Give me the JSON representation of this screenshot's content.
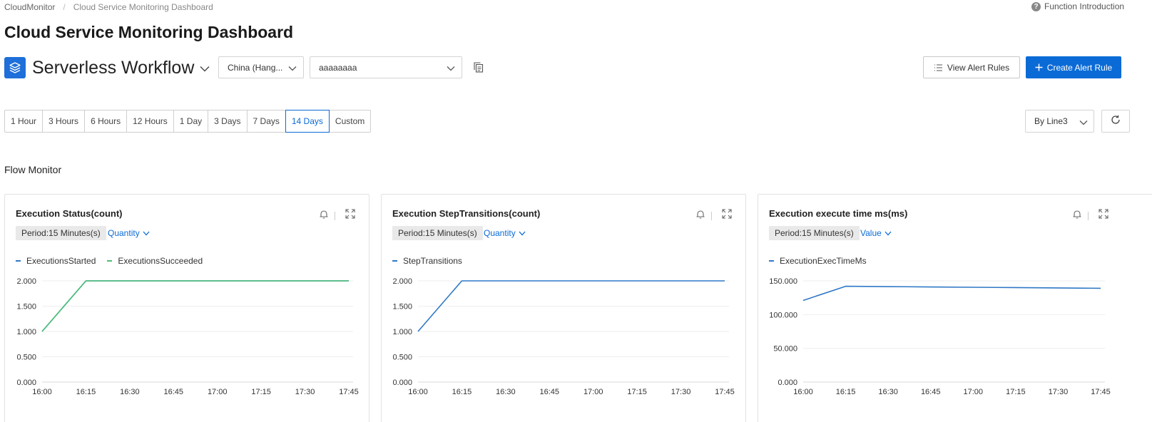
{
  "breadcrumb": {
    "root": "CloudMonitor",
    "separator": "/",
    "current": "Cloud Service Monitoring Dashboard"
  },
  "help": {
    "label": "Function Introduction"
  },
  "page_title": "Cloud Service Monitoring Dashboard",
  "product": {
    "name": "Serverless Workflow",
    "icon": "layers-icon"
  },
  "region_select": {
    "value": "China (Hang..."
  },
  "instance_select": {
    "value": "aaaaaaaa"
  },
  "buttons": {
    "view_alert_rules": "View Alert Rules",
    "create_alert_rule": "Create Alert Rule"
  },
  "time_ranges": [
    "1 Hour",
    "3 Hours",
    "6 Hours",
    "12 Hours",
    "1 Day",
    "3 Days",
    "7 Days",
    "14 Days",
    "Custom"
  ],
  "active_time_range": "14 Days",
  "line_select": {
    "value": "By Line3"
  },
  "section_title": "Flow Monitor",
  "colors": {
    "accent": "#0b6bd6",
    "series_blue": "#2f78c6",
    "series_green": "#4bbf73"
  },
  "panels": [
    {
      "title": "Execution Status(count)",
      "period": "Period:15 Minutes(s)",
      "metric": "Quantity"
    },
    {
      "title": "Execution StepTransitions(count)",
      "period": "Period:15 Minutes(s)",
      "metric": "Quantity"
    },
    {
      "title": "Execution execute time ms(ms)",
      "period": "Period:15 Minutes(s)",
      "metric": "Value"
    }
  ],
  "chart_data": [
    {
      "type": "line",
      "title": "Execution Status(count)",
      "x": [
        "16:00",
        "16:15",
        "16:30",
        "16:45",
        "17:00",
        "17:15",
        "17:30",
        "17:45"
      ],
      "ylim": [
        0,
        2
      ],
      "y_ticks": [
        "0.000",
        "0.500",
        "1.000",
        "1.500",
        "2.000"
      ],
      "grid": true,
      "legend_position": "top-left",
      "series": [
        {
          "name": "ExecutionsStarted",
          "color": "#2f78c6",
          "values": [
            1,
            2,
            2,
            2,
            2,
            2,
            2,
            2
          ]
        },
        {
          "name": "ExecutionsSucceeded",
          "color": "#4bbf73",
          "values": [
            1,
            2,
            2,
            2,
            2,
            2,
            2,
            2
          ]
        }
      ]
    },
    {
      "type": "line",
      "title": "Execution StepTransitions(count)",
      "x": [
        "16:00",
        "16:15",
        "16:30",
        "16:45",
        "17:00",
        "17:15",
        "17:30",
        "17:45"
      ],
      "ylim": [
        0,
        2
      ],
      "y_ticks": [
        "0.000",
        "0.500",
        "1.000",
        "1.500",
        "2.000"
      ],
      "grid": true,
      "legend_position": "top-left",
      "series": [
        {
          "name": "StepTransitions",
          "color": "#2f78c6",
          "values": [
            1,
            2,
            2,
            2,
            2,
            2,
            2,
            2
          ]
        }
      ]
    },
    {
      "type": "line",
      "title": "Execution execute time ms(ms)",
      "x": [
        "16:00",
        "16:15",
        "16:30",
        "16:45",
        "17:00",
        "17:15",
        "17:30",
        "17:45"
      ],
      "ylim": [
        0,
        150
      ],
      "y_ticks": [
        "0.000",
        "50.000",
        "100.000",
        "150.000"
      ],
      "grid": true,
      "legend_position": "top-left",
      "series": [
        {
          "name": "ExecutionExecTimeMs",
          "color": "#2f78c6",
          "values": [
            121,
            142,
            141.5,
            141,
            140.5,
            140,
            139.5,
            139
          ]
        }
      ]
    }
  ]
}
